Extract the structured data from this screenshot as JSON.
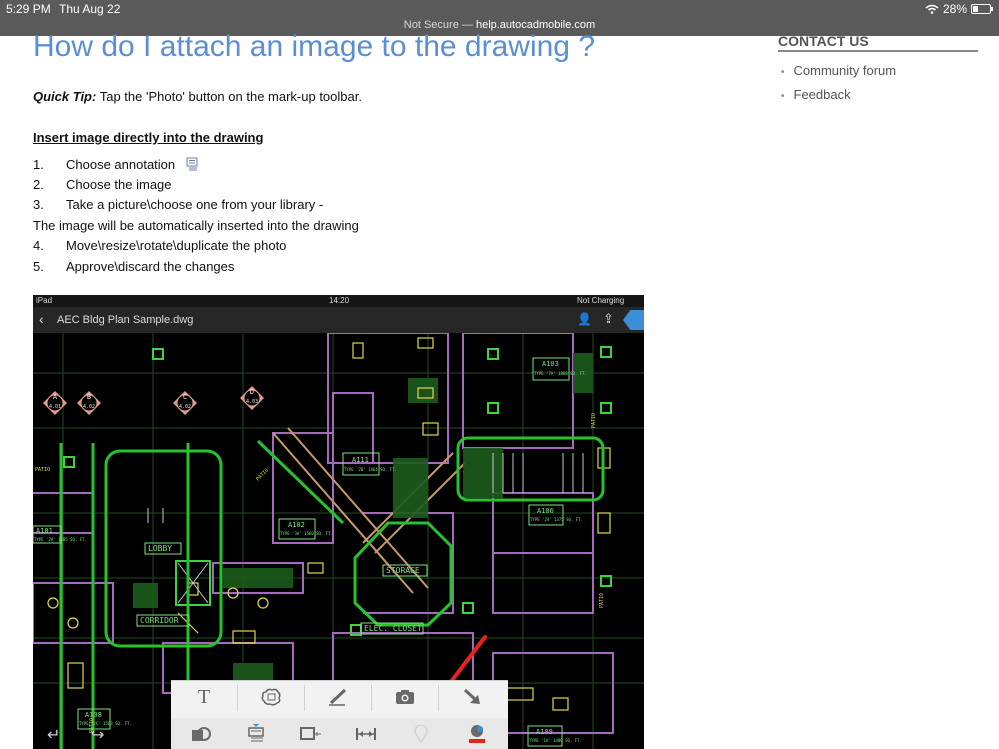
{
  "status_bar": {
    "time": "5:29 PM",
    "date": "Thu Aug 22",
    "battery": "28%",
    "battery_level": 0.28
  },
  "url_bar": {
    "security": "Not Secure —",
    "domain": "help.autocadmobile.com"
  },
  "article": {
    "title": "How do I attach an image to the drawing ?",
    "tip_label": "Quick Tip:",
    "tip_text": "Tap the 'Photo' button on the mark-up toolbar.",
    "section_heading": "Insert image directly into the drawing",
    "steps": [
      {
        "num": "1.",
        "text": "Choose annotation"
      },
      {
        "num": "2.",
        "text": "Choose the image"
      },
      {
        "num": "3.",
        "text": "Take a picture\\choose one from your library -"
      },
      {
        "num": "4.",
        "text": "Move\\resize\\rotate\\duplicate the photo"
      },
      {
        "num": "5.",
        "text": "Approve\\discard the changes"
      }
    ],
    "note": "The image will be automatically inserted into the drawing"
  },
  "sidebar": {
    "title": "CONTACT US",
    "links": [
      "Community forum",
      "Feedback"
    ]
  },
  "screenshot": {
    "device": "iPad",
    "time": "14:20",
    "charging": "Not Charging",
    "file_name": "AEC Bldg Plan Sample.dwg",
    "room_labels": [
      "LOBBY",
      "CORRIDOR",
      "STORAGE",
      "ELEC. CLOSET"
    ],
    "unit_labels": [
      "A101",
      "A102",
      "A103",
      "A106",
      "A108",
      "A109",
      "A111"
    ],
    "unit_info_labels": [
      "TYPE '2A' 1385 SQ. FT.",
      "TYPE '2B' 1464 SQ. FT.",
      "TYPE '3A' 1560 SQ. FT.",
      "TYPE '7A' 1868 SQ. FT.",
      "TYPE '2A' 1375 SQ. FT.",
      "TYPE '2C' 1563 SQ. FT.",
      "TYPE '1A' 1480 SQ. FT."
    ],
    "grid_labels": [
      "A",
      "B",
      "C",
      "D"
    ],
    "grid_dims": [
      "4.01",
      "4.02",
      "4.02",
      "4.03"
    ],
    "patio_labels": [
      "PATIO",
      "PATIO",
      "PATIO",
      "PATIO",
      "PATIO"
    ],
    "colors": {
      "accent_arrow": "#e8221d",
      "highlight": "#27c22d"
    }
  }
}
